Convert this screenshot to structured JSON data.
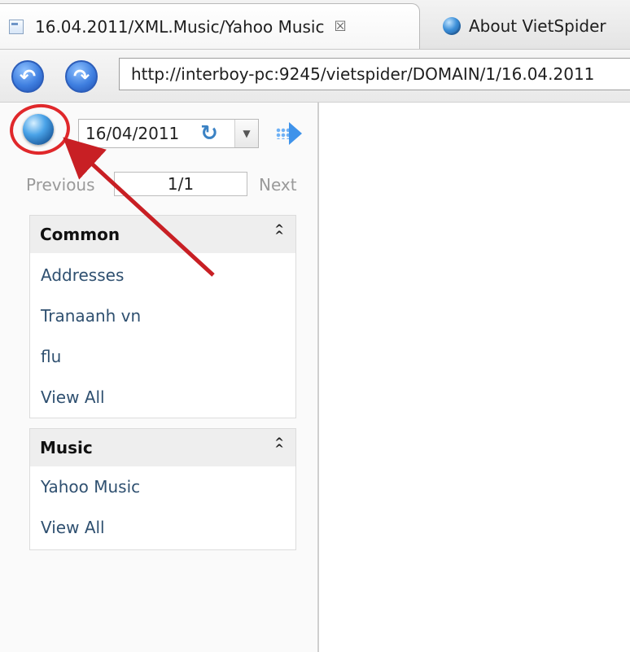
{
  "tabs": [
    {
      "label": "16.04.2011/XML.Music/Yahoo Music",
      "close": "☒",
      "icon": "page-icon"
    },
    {
      "label": "About VietSpider",
      "icon": "globe-icon"
    }
  ],
  "nav": {
    "back_icon": "back-arrow-icon",
    "forward_icon": "forward-arrow-icon",
    "address": "http://interboy-pc:9245/vietspider/DOMAIN/1/16.04.2011"
  },
  "sidebar": {
    "date": "16/04/2011",
    "pager": {
      "previous": "Previous",
      "page": "1/1",
      "next": "Next"
    },
    "panels": [
      {
        "title": "Common",
        "items": [
          "Addresses",
          "Tranaanh vn",
          "flu",
          "View All"
        ]
      },
      {
        "title": "Music",
        "items": [
          "Yahoo Music",
          "View All"
        ]
      }
    ]
  },
  "colors": {
    "annotation": "#e0282b",
    "link": "#2f5070",
    "accent_blue": "#3f93ea"
  }
}
